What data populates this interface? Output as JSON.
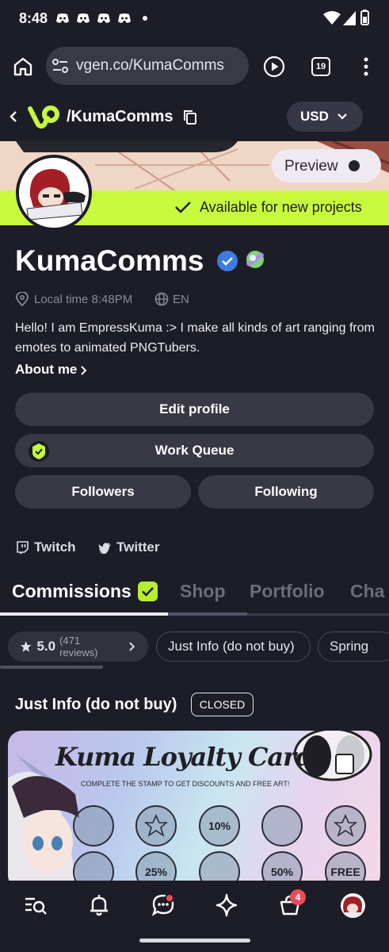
{
  "status_bar": {
    "time": "8:48"
  },
  "browser": {
    "url": "vgen.co/KumaComms",
    "tab_count": "19"
  },
  "site": {
    "path": "/KumaComms",
    "currency": "USD"
  },
  "banner": {
    "preview_label": "Preview",
    "availability": "Available for new projects"
  },
  "profile": {
    "name": "KumaComms",
    "local_time": "Local time 8:48PM",
    "language": "EN",
    "bio": "Hello! I am EmpressKuma :> I make all kinds of art ranging from emotes to animated PNGTubers.",
    "about_label": "About me",
    "buttons": {
      "edit": "Edit profile",
      "work_queue": "Work Queue",
      "followers": "Followers",
      "following": "Following"
    },
    "socials": [
      "Twitch",
      "Twitter"
    ]
  },
  "tabs": [
    "Commissions",
    "Shop",
    "Portfolio",
    "Cha"
  ],
  "filters": {
    "rating": "5.0",
    "reviews": "(471 reviews)",
    "chips": [
      "Just Info (do not buy)",
      "Spring"
    ]
  },
  "section": {
    "title": "Just Info (do not buy)",
    "status": "CLOSED"
  },
  "card": {
    "title": "Kuma Loyalty Card",
    "subtitle": "COMPLETE THE STAMP TO GET DISCOUNTS AND FREE ART!",
    "stamps": [
      "",
      "",
      "10%",
      "",
      "",
      "",
      "25%",
      "",
      "50%",
      "FREE"
    ]
  },
  "bottom_nav": {
    "cart_count": "4"
  },
  "colors": {
    "accent": "#c7fa3c",
    "background": "#1d1d27",
    "button": "#393946",
    "verified": "#3e7be0",
    "badge_red": "#ef4a5a"
  }
}
